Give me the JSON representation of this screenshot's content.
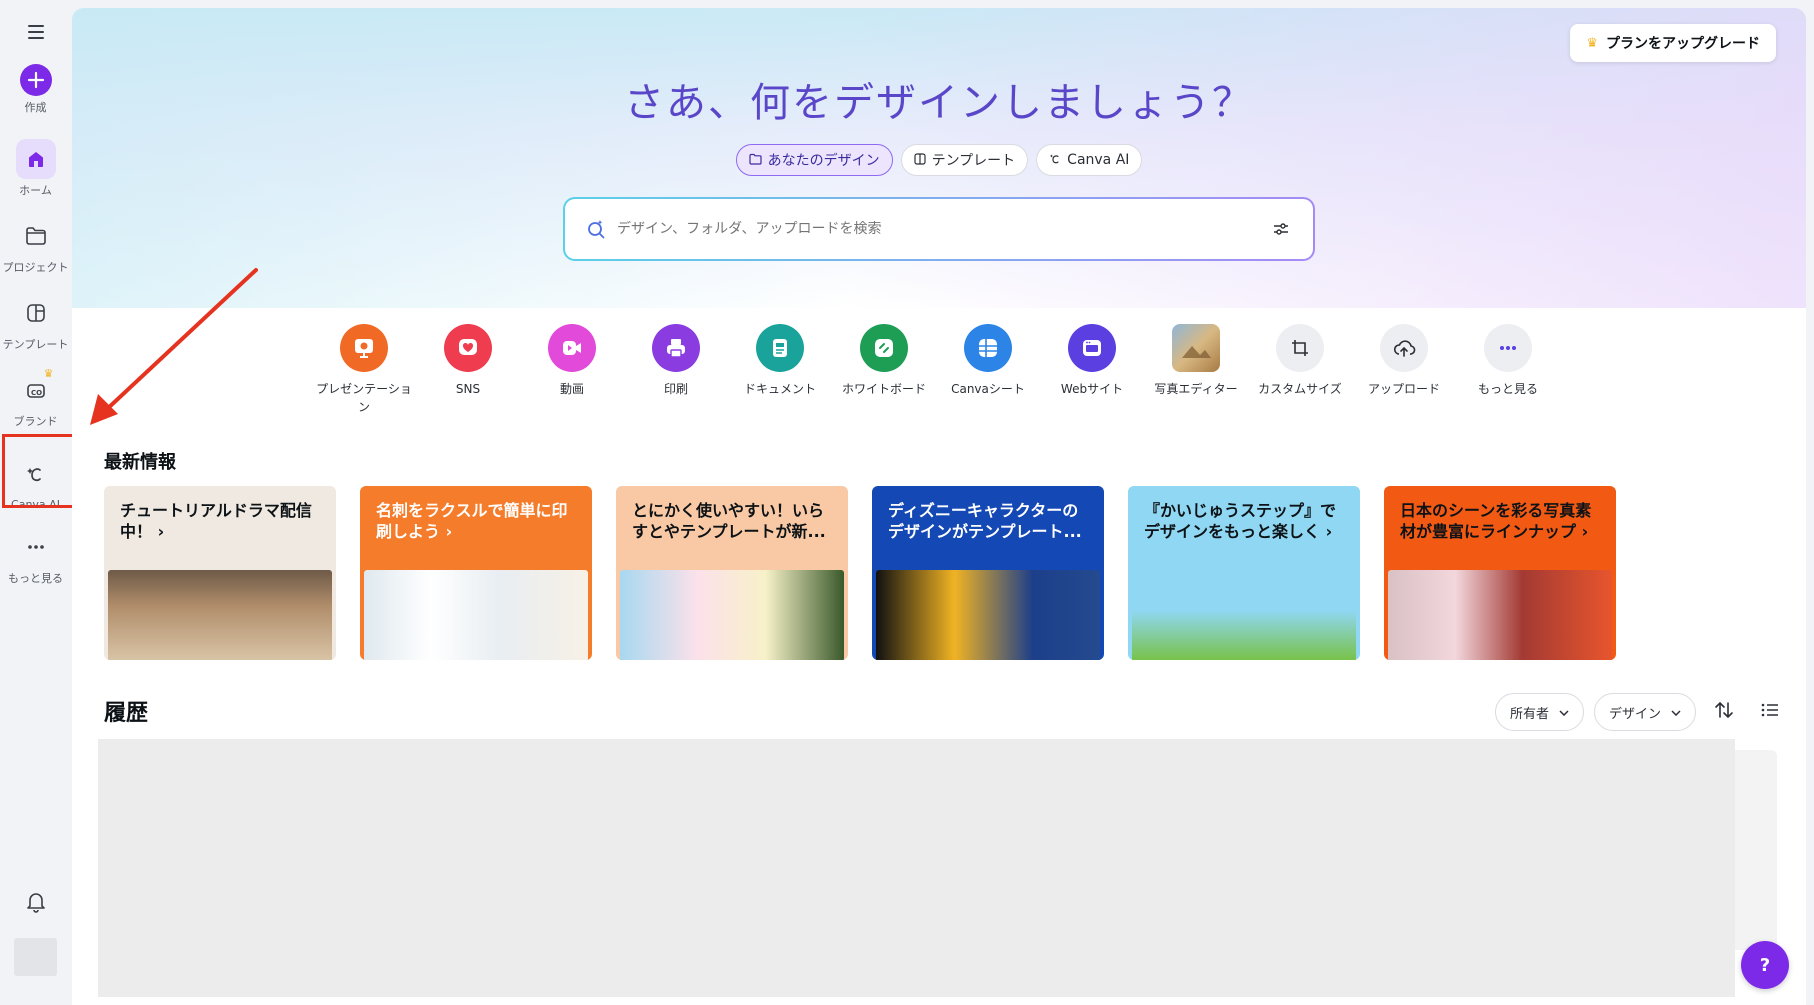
{
  "sidebar": {
    "menu_icon": "hamburger-icon",
    "items": [
      {
        "label": "作成",
        "icon": "plus-icon"
      },
      {
        "label": "ホーム",
        "icon": "home-icon"
      },
      {
        "label": "プロジェクト",
        "icon": "folder-icon"
      },
      {
        "label": "テンプレート",
        "icon": "template-icon"
      },
      {
        "label": "ブランド",
        "icon": "brand-icon"
      },
      {
        "label": "Canva AI",
        "icon": "canva-ai-icon"
      },
      {
        "label": "もっと見る",
        "icon": "more-icon"
      }
    ],
    "bell_icon": "bell-icon"
  },
  "header": {
    "upgrade_label": "プランをアップグレード",
    "title": "さあ、何をデザインしましょう？"
  },
  "pills": [
    {
      "label": "あなたのデザイン",
      "active": true
    },
    {
      "label": "テンプレート",
      "active": false
    },
    {
      "label": "Canva AI",
      "active": false
    }
  ],
  "search": {
    "placeholder": "デザイン、フォルダ、アップロードを検索"
  },
  "actions": [
    {
      "label": "プレゼンテーション",
      "color": "#f06a25"
    },
    {
      "label": "SNS",
      "color": "#ef3c4f"
    },
    {
      "label": "動画",
      "color": "#e24ad9"
    },
    {
      "label": "印刷",
      "color": "#8a3ce0"
    },
    {
      "label": "ドキュメント",
      "color": "#1aa39a"
    },
    {
      "label": "ホワイトボード",
      "color": "#1e9d55"
    },
    {
      "label": "Canvaシート",
      "color": "#2b84e6"
    },
    {
      "label": "Webサイト",
      "color": "#5b3fe0"
    },
    {
      "label": "写真エディター",
      "color": "#c8a46e"
    },
    {
      "label": "カスタムサイズ",
      "color": "#eceef1"
    },
    {
      "label": "アップロード",
      "color": "#eceef1"
    },
    {
      "label": "もっと見る",
      "color": "#eceef1"
    }
  ],
  "latest": {
    "title": "最新情報",
    "cards": [
      {
        "title": "チュートリアルドラマ配信中！ ›",
        "bg": "#efe9e2",
        "fg": "#0d1216"
      },
      {
        "title": "名刺をラクスルで簡単に印刷しよう ›",
        "bg": "#f57c2a",
        "fg": "#ffffff"
      },
      {
        "title": "とにかく使いやすい！いらすとやテンプレートが新...",
        "bg": "#f8c9a4",
        "fg": "#0d1216"
      },
      {
        "title": "ディズニーキャラクターのデザインがテンプレート...",
        "bg": "#1448b4",
        "fg": "#ffffff"
      },
      {
        "title": "『かいじゅうステップ』でデザインをもっと楽しく ›",
        "bg": "#8fd7f2",
        "fg": "#0d1216"
      },
      {
        "title": "日本のシーンを彩る写真素材が豊富にラインナップ ›",
        "bg": "#f25a14",
        "fg": "#0d1216"
      }
    ]
  },
  "history": {
    "title": "履歴",
    "owner_label": "所有者",
    "type_label": "デザイン"
  },
  "help_label": "?"
}
